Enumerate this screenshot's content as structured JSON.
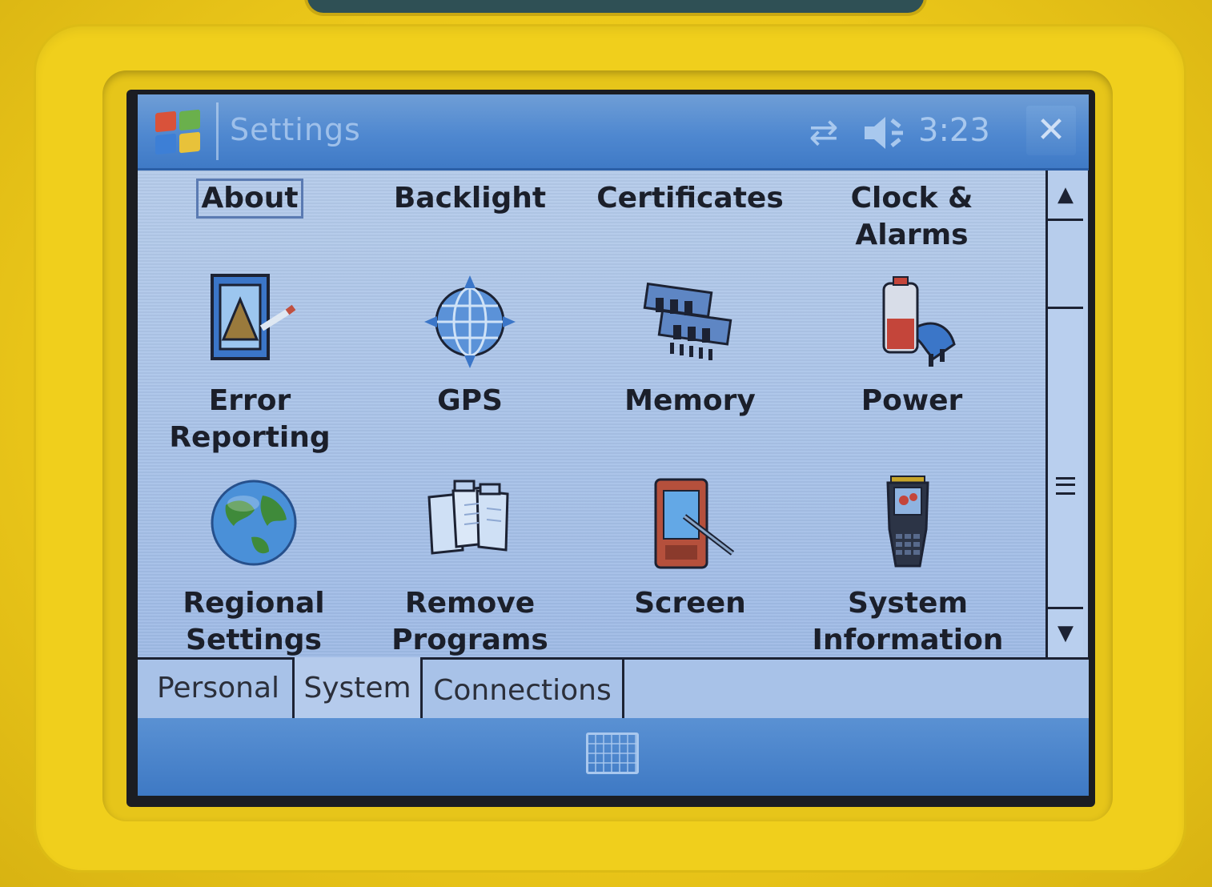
{
  "titlebar": {
    "title": "Settings",
    "time": "3:23",
    "close_label": "✕"
  },
  "items": [
    {
      "label": "About",
      "icon": "about-icon"
    },
    {
      "label": "Backlight",
      "icon": "backlight-icon"
    },
    {
      "label": "Certificates",
      "icon": "certificates-icon"
    },
    {
      "label": "Clock &\nAlarms",
      "icon": "clock-alarms-icon"
    },
    {
      "label": "Error\nReporting",
      "icon": "error-reporting-icon"
    },
    {
      "label": "GPS",
      "icon": "gps-icon"
    },
    {
      "label": "Memory",
      "icon": "memory-icon"
    },
    {
      "label": "Power",
      "icon": "power-icon"
    },
    {
      "label": "Regional\nSettings",
      "icon": "globe-icon"
    },
    {
      "label": "Remove\nPrograms",
      "icon": "remove-programs-icon"
    },
    {
      "label": "Screen",
      "icon": "screen-icon"
    },
    {
      "label": "System\nInformation",
      "icon": "system-information-icon"
    }
  ],
  "tabs": [
    {
      "label": "Personal",
      "selected": false
    },
    {
      "label": "System",
      "selected": true
    },
    {
      "label": "Connections",
      "selected": false
    }
  ],
  "colors": {
    "casing": "#f0cf1c",
    "titlebar": "#4f88d0",
    "content": "#a9c3ea",
    "text": "#1b1f2a"
  }
}
